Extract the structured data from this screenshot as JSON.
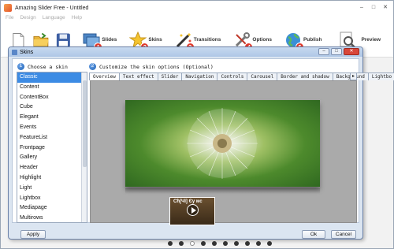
{
  "app": {
    "title": "Amazing Slider Free - Untitled"
  },
  "menu": [
    "File",
    "Design",
    "Language",
    "Help"
  ],
  "toolbar": {
    "items": [
      {
        "label": "Slides",
        "step": "1"
      },
      {
        "label": "Skins",
        "step": "2"
      },
      {
        "label": "Transitions",
        "step": "3"
      },
      {
        "label": "Options",
        "step": "4"
      },
      {
        "label": "Publish",
        "step": "5"
      },
      {
        "label": "Preview",
        "step": ""
      }
    ]
  },
  "dialog": {
    "title": "Skins",
    "choose_skin": {
      "number": "1",
      "label": "Choose a skin"
    },
    "customize": {
      "number": "2",
      "label": "Customize the skin options (Optional)"
    },
    "skins": [
      "Classic",
      "Content",
      "ContentBox",
      "Cube",
      "Elegant",
      "Events",
      "FeatureList",
      "Frontpage",
      "Gallery",
      "Header",
      "Highlight",
      "Light",
      "Lightbox",
      "Mediapage",
      "Multirows"
    ],
    "selected_skin": "Classic",
    "tabs": [
      "Overview",
      "Text effect",
      "Slider",
      "Navigation",
      "Controls",
      "Carousel",
      "Border and shadow",
      "Background",
      "Lightbo"
    ],
    "active_tab": "Overview",
    "thumb_caption": "Сћ[Чї] Єу мс",
    "dots": 10,
    "active_dot": 3,
    "buttons": {
      "apply": "Apply",
      "ok": "Ok",
      "cancel": "Cancel"
    }
  }
}
